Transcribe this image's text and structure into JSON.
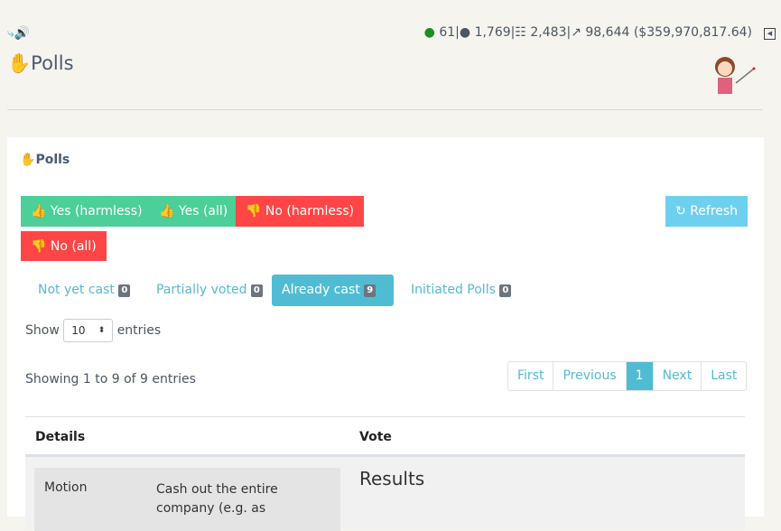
{
  "header": {
    "title": "Polls",
    "stats": {
      "online": "61",
      "members": "1,769",
      "network": "2,483",
      "volume": "98,644 ($359,970,817.64)"
    },
    "icons": [
      "share-icon",
      "speaker-icon",
      "user-icon",
      "users-icon",
      "sitemap-icon",
      "chart-line-icon",
      "collapse-icon"
    ]
  },
  "panel": {
    "title": "Polls",
    "buttons": {
      "yes_harmless": "Yes (harmless)",
      "yes_all": "Yes (all)",
      "no_harmless": "No (harmless)",
      "no_all": "No (all)",
      "refresh": "Refresh"
    },
    "tabs": [
      {
        "label": "Not yet cast",
        "count": "0"
      },
      {
        "label": "Partially voted",
        "count": "0"
      },
      {
        "label": "Already cast",
        "count": "9",
        "active": true
      },
      {
        "label": "Initiated Polls",
        "count": "0"
      }
    ],
    "length": {
      "show": "Show",
      "value": "10",
      "entries": "entries"
    },
    "info": "Showing 1 to 9 of 9 entries",
    "pager": {
      "first": "First",
      "previous": "Previous",
      "current": "1",
      "next": "Next",
      "last": "Last"
    },
    "table": {
      "headers": [
        "Details",
        "Vote"
      ],
      "rows": [
        {
          "label": "Motion",
          "text": "Cash out the entire company (e.g. as",
          "vote_heading": "Results"
        }
      ]
    }
  },
  "colors": {
    "green": "#4ccf98",
    "red": "#ff4545",
    "accent": "#50bcd4"
  }
}
